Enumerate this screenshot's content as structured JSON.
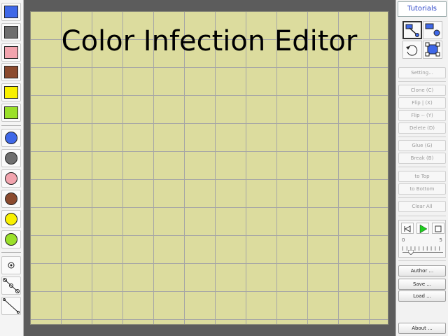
{
  "title": "Color Infection Editor",
  "palette": {
    "squares": [
      "#3f68e8",
      "#6e6e6e",
      "#f2a4ae",
      "#8b4a2e",
      "#f8f000",
      "#9be02a"
    ],
    "circles": [
      "#3f68e8",
      "#6e6e6e",
      "#f2a4ae",
      "#8b4a2e",
      "#f8f000",
      "#9be02a"
    ],
    "tools": [
      "pin-tool-icon",
      "chain-joint-tool-icon",
      "line-tool-icon"
    ]
  },
  "right": {
    "tutorials": "Tutorials",
    "setting": "Setting...",
    "clone": "Clone (C)",
    "flip_h": "Flip | (X)",
    "flip_v": "Flip -- (Y)",
    "delete": "Delete (D)",
    "glue": "Glue (G)",
    "break": "Break (B)",
    "to_top": "to Top",
    "to_bottom": "to Bottom",
    "clear_all": "Clear All",
    "author": "Author ...",
    "save": "Save ...",
    "load": "Load ...",
    "about": "About ..."
  },
  "player": {
    "slider_min": "0",
    "slider_max": "5",
    "slider_value": 0.2
  },
  "colors": {
    "grid_bg": "#dcdc9e",
    "frame_bg": "#5c5c5c",
    "play_green": "#1fcf1f",
    "tutorials_blue": "#2a44c8"
  }
}
